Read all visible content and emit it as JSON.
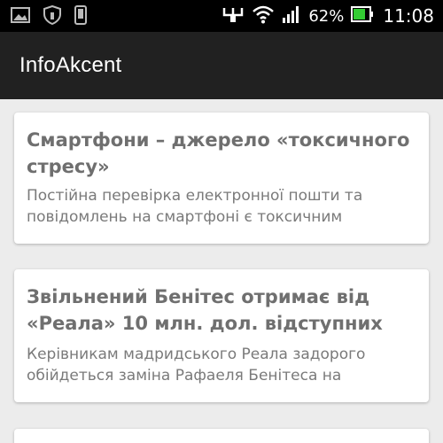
{
  "status_bar": {
    "battery_percent": "62%",
    "time": "11:08",
    "icons": [
      "gallery-icon",
      "shield-icon",
      "phone-icon",
      "usb-icon",
      "wifi-icon",
      "signal-icon",
      "battery-icon"
    ]
  },
  "app_bar": {
    "title": "InfoAkcent"
  },
  "feed": {
    "items": [
      {
        "title": "Смартфони – джерело «токсичного стресу»",
        "summary": "Постійна перевірка електронної пошти та повідомлень на смартфоні є токсичним"
      },
      {
        "title": "Звільнений Бенітес отримає від «Реала» 10 млн. дол. відступних",
        "summary": "Керівникам мадридського Реала задорого обійдеться заміна Рафаеля Бенітеса на"
      }
    ]
  },
  "colors": {
    "status_bar_bg": "#000000",
    "app_bar_bg": "#212121",
    "page_bg": "#ececec",
    "card_bg": "#ffffff",
    "title_text": "#6f6f6f",
    "body_text": "#7a7a7a"
  }
}
